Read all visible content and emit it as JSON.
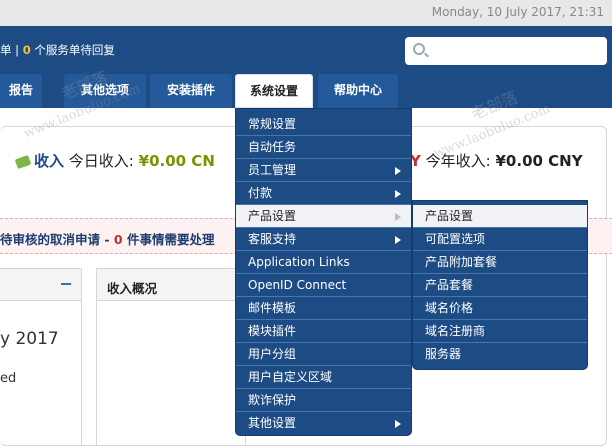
{
  "header": {
    "date": "Monday, 10 July 2017, 21:31",
    "orders_prefix": "单 | ",
    "orders_count": "0",
    "orders_suffix": " 个服务单待回复"
  },
  "nav": {
    "tabs": [
      "报告",
      "其他选项",
      "安装插件",
      "系统设置",
      "帮助中心"
    ],
    "active": "系统设置"
  },
  "income": {
    "label": "收入",
    "today_label": "今日收入:",
    "today_value": "¥0.00 CN",
    "year_prefix": "Y",
    "year_label": "今年收入:",
    "year_value": "¥0.00 CNY"
  },
  "alert": {
    "part1": "待审核的取消申请",
    "sep": " - ",
    "count": "0",
    "part2": " 件事情需要处理"
  },
  "panels": {
    "left_year": "y 2017",
    "left_ed": "ed",
    "mid_title": "收入概况"
  },
  "menu_system": [
    {
      "label": "常规设置",
      "submenu": false
    },
    {
      "label": "自动任务",
      "submenu": false
    },
    {
      "label": "员工管理",
      "submenu": true
    },
    {
      "label": "付款",
      "submenu": true
    },
    {
      "label": "产品设置",
      "submenu": true,
      "hover": true
    },
    {
      "label": "客服支持",
      "submenu": true
    },
    {
      "label": "Application Links",
      "submenu": false
    },
    {
      "label": "OpenID Connect",
      "submenu": false
    },
    {
      "label": "邮件模板",
      "submenu": false
    },
    {
      "label": "模块插件",
      "submenu": false
    },
    {
      "label": "用户分组",
      "submenu": false
    },
    {
      "label": "用户自定义区域",
      "submenu": false
    },
    {
      "label": "欺诈保护",
      "submenu": false
    },
    {
      "label": "其他设置",
      "submenu": true
    }
  ],
  "menu_product": [
    {
      "label": "产品设置",
      "hover": true
    },
    {
      "label": "可配置选项"
    },
    {
      "label": "产品附加套餐"
    },
    {
      "label": "产品套餐"
    },
    {
      "label": "域名价格"
    },
    {
      "label": "域名注册商"
    },
    {
      "label": "服务器"
    }
  ],
  "watermarks": [
    "老部落",
    "www.laobuluo.com"
  ],
  "colors": {
    "nav_blue": "#1d4c85",
    "accent_yellow": "#f5c02d",
    "income_green": "#779500",
    "alert_red": "#c03030"
  }
}
